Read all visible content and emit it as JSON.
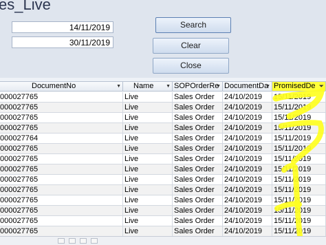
{
  "form": {
    "title": "es_Live",
    "date_from": "14/11/2019",
    "date_to": "30/11/2019",
    "search_label": "Search",
    "clear_label": "Clear",
    "close_label": "Close"
  },
  "grid": {
    "columns": [
      "DocumentNo",
      "Name",
      "SOPOrderRe",
      "DocumentDa",
      "PromisedDe"
    ],
    "rows": [
      [
        "000027765",
        "Live",
        "Sales Order",
        "24/10/2019",
        "15/11/2019"
      ],
      [
        "000027765",
        "Live",
        "Sales Order",
        "24/10/2019",
        "15/11/2019"
      ],
      [
        "000027765",
        "Live",
        "Sales Order",
        "24/10/2019",
        "15/11/2019"
      ],
      [
        "000027765",
        "Live",
        "Sales Order",
        "24/10/2019",
        "15/11/2019"
      ],
      [
        "000027764",
        "Live",
        "Sales Order",
        "24/10/2019",
        "15/11/2019"
      ],
      [
        "000027765",
        "Live",
        "Sales Order",
        "24/10/2019",
        "15/11/2019"
      ],
      [
        "000027765",
        "Live",
        "Sales Order",
        "24/10/2019",
        "15/11/2019"
      ],
      [
        "000027765",
        "Live",
        "Sales Order",
        "24/10/2019",
        "15/11/2019"
      ],
      [
        "000027765",
        "Live",
        "Sales Order",
        "24/10/2019",
        "15/11/2019"
      ],
      [
        "000027765",
        "Live",
        "Sales Order",
        "24/10/2019",
        "15/11/2019"
      ],
      [
        "000027765",
        "Live",
        "Sales Order",
        "24/10/2019",
        "15/11/2019"
      ],
      [
        "000027765",
        "Live",
        "Sales Order",
        "24/10/2019",
        "15/11/2019"
      ],
      [
        "000027765",
        "Live",
        "Sales Order",
        "24/10/2019",
        "15/11/2019"
      ],
      [
        "000027765",
        "Live",
        "Sales Order",
        "24/10/2019",
        "15/11/2019"
      ]
    ]
  },
  "colors": {
    "highlight": "#ffff3a",
    "form_bg": "#dfe5ee",
    "button_border": "#8fa7c6"
  },
  "icons": [
    "dropdown-arrow-icon",
    "filter-icon"
  ]
}
